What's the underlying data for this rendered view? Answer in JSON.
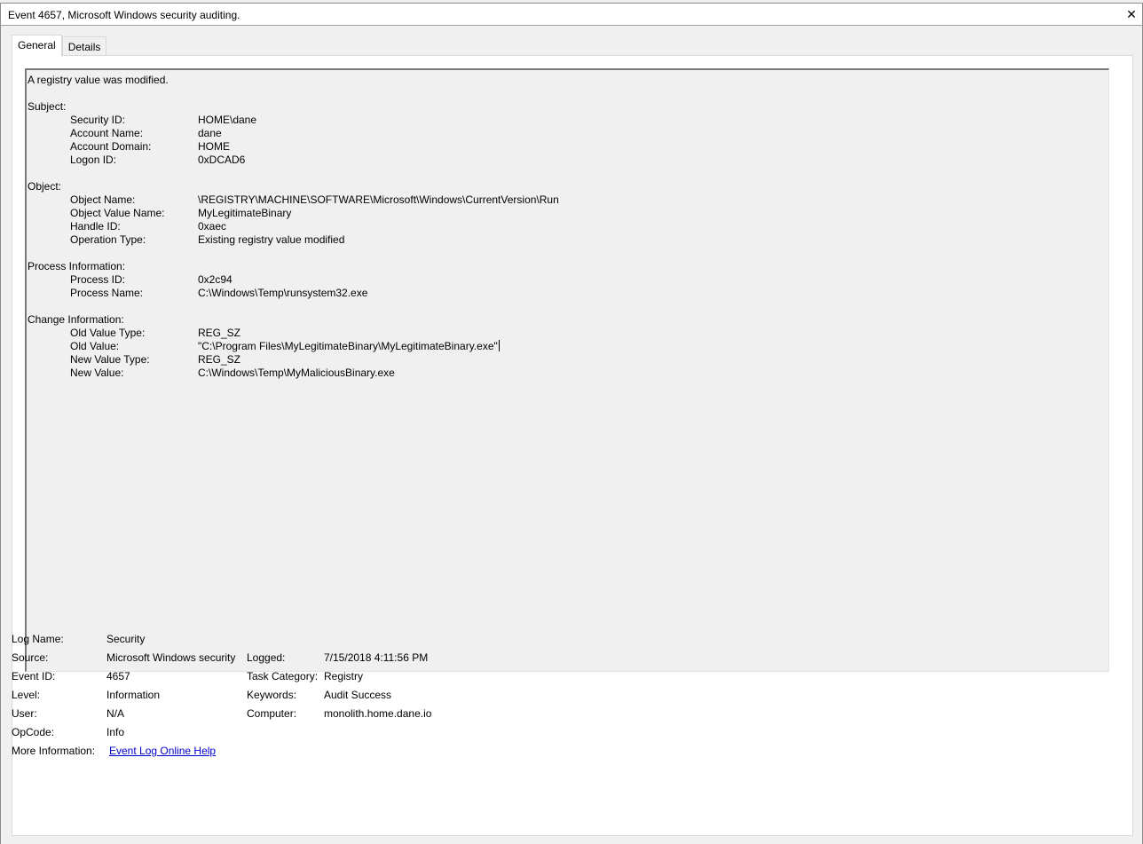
{
  "window": {
    "title": "Event 4657, Microsoft Windows security auditing.",
    "close_glyph": "✕"
  },
  "tabs": [
    {
      "label": "General",
      "active": true
    },
    {
      "label": "Details",
      "active": false
    }
  ],
  "description": {
    "headline": "A registry value was modified.",
    "subject": {
      "heading": "Subject:",
      "fields": [
        {
          "key": "Security ID:",
          "value": "HOME\\dane"
        },
        {
          "key": "Account Name:",
          "value": "dane"
        },
        {
          "key": "Account Domain:",
          "value": "HOME"
        },
        {
          "key": "Logon ID:",
          "value": "0xDCAD6"
        }
      ]
    },
    "object": {
      "heading": "Object:",
      "fields": [
        {
          "key": "Object Name:",
          "value": "\\REGISTRY\\MACHINE\\SOFTWARE\\Microsoft\\Windows\\CurrentVersion\\Run"
        },
        {
          "key": "Object Value Name:",
          "value": "MyLegitimateBinary"
        },
        {
          "key": "Handle ID:",
          "value": "0xaec"
        },
        {
          "key": "Operation Type:",
          "value": "Existing registry value modified"
        }
      ]
    },
    "process": {
      "heading": "Process Information:",
      "fields": [
        {
          "key": "Process ID:",
          "value": "0x2c94"
        },
        {
          "key": "Process Name:",
          "value": "C:\\Windows\\Temp\\runsystem32.exe"
        }
      ]
    },
    "change": {
      "heading": "Change Information:",
      "fields": [
        {
          "key": "Old Value Type:",
          "value": "REG_SZ"
        },
        {
          "key": "Old Value:",
          "value": "\"C:\\Program Files\\MyLegitimateBinary\\MyLegitimateBinary.exe\""
        },
        {
          "key": "New Value Type:",
          "value": "REG_SZ"
        },
        {
          "key": "New Value:",
          "value": "C:\\Windows\\Temp\\MyMaliciousBinary.exe"
        }
      ]
    }
  },
  "meta": {
    "log_name": {
      "label": "Log Name:",
      "value": "Security"
    },
    "source": {
      "label": "Source:",
      "value": "Microsoft Windows security"
    },
    "logged": {
      "label": "Logged:",
      "value": "7/15/2018 4:11:56 PM"
    },
    "event_id": {
      "label": "Event ID:",
      "value": "4657"
    },
    "task_category": {
      "label": "Task Category:",
      "value": "Registry"
    },
    "level": {
      "label": "Level:",
      "value": "Information"
    },
    "keywords": {
      "label": "Keywords:",
      "value": "Audit Success"
    },
    "user": {
      "label": "User:",
      "value": "N/A"
    },
    "computer": {
      "label": "Computer:",
      "value": "monolith.home.dane.io"
    },
    "opcode": {
      "label": "OpCode:",
      "value": "Info"
    },
    "more_info": {
      "label": "More Information:",
      "link": "Event Log Online Help"
    }
  }
}
